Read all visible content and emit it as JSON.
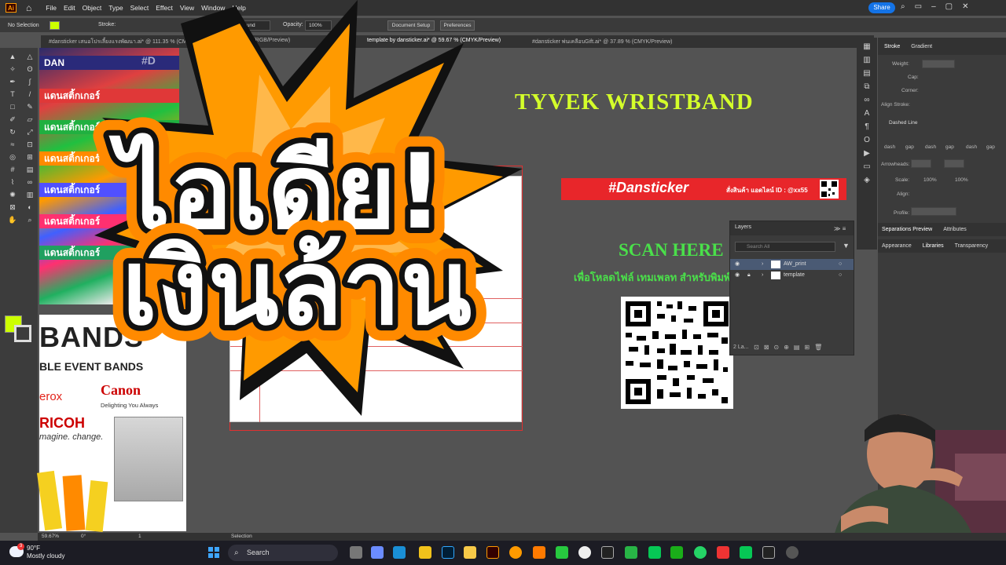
{
  "menubar": {
    "items": [
      "File",
      "Edit",
      "Object",
      "Type",
      "Select",
      "Effect",
      "View",
      "Window",
      "Help"
    ],
    "share_label": "Share"
  },
  "control_bar": {
    "selection_label": "No Selection",
    "stroke_label": "Stroke:",
    "brush_value": "5 pt. Round",
    "opacity_label": "Opacity:",
    "opacity_value": "100%",
    "document_setup_label": "Document Setup",
    "preferences_label": "Preferences"
  },
  "doc_tabs": [
    "#dansticker เสนอโปรเลี้ยงแรงพัฒนา.ai* @ 111.35 % (CMYK/Preview)",
    "Untitled-1* @ 20.8% (RGB/Preview)",
    "template by dansticker.ai* @ 59.67 % (CMYK/Preview)",
    "#dansticker พ่นเคลือบGift.ai* @ 37.89 % (CMYK/Preview)"
  ],
  "artwork": {
    "title": "TYVEK WRISTBAND",
    "banner_brand": "#Dansticker",
    "banner_contact": "สั่งสินค้า แอดไลน์ ID : @xx55",
    "scan_here": "SCAN HERE",
    "download_text": "เพื่อโหลดไฟล์ เทมเพลท สำหรับพิมพ์",
    "photo_bands": [
      "DAN",
      "แดนสติ้กเกอร์",
      "แดนสติ้กเกอร์",
      "แดนสติ้กเกอร์",
      "แดนสติ้กเกอร์",
      "แดนสติ้กเกอร์",
      "แดนสติ้กเกอร์"
    ],
    "photo_tag": "#D",
    "bands_title": "BANDS",
    "bands_subtitle": "BLE EVENT BANDS",
    "xerox": "erox",
    "canon": "Canon",
    "canon_tagline": "Delighting You Always",
    "ricoh": "RICOH",
    "ricoh_tagline": "magine. change."
  },
  "thumbnail_overlay": {
    "line1": "ไอเดีย!",
    "line2": "เงินล้าน"
  },
  "layers_panel": {
    "title": "Layers",
    "search_placeholder": "Search All",
    "layers": [
      "AW_print",
      "template"
    ],
    "footer": "2 La..."
  },
  "right_panel": {
    "tabs": [
      "Stroke",
      "Gradient"
    ],
    "weight_label": "Weight:",
    "cap_label": "Cap:",
    "corner_label": "Corner:",
    "align_stroke_label": "Align Stroke:",
    "dashed_line_label": "Dashed Line",
    "dash_labels": [
      "dash",
      "gap",
      "dash",
      "gap",
      "dash",
      "gap"
    ],
    "arrowheads_label": "Arrowheads:",
    "scale_label": "Scale:",
    "scale_values": [
      "100%",
      "100%"
    ],
    "align_label": "Align:",
    "profile_label": "Profile:",
    "sep_tabs": [
      "Separations Preview",
      "Attributes"
    ],
    "lib_tabs": [
      "Appearance",
      "Libraries",
      "Transparency"
    ]
  },
  "status_bar": {
    "zoom": "59.67%",
    "rotation": "0°",
    "artboard": "1",
    "tool": "Selection"
  },
  "taskbar": {
    "temp": "90°F",
    "weather": "Mostly cloudy",
    "search_label": "Search",
    "weather_badge": "3"
  },
  "colors": {
    "accent_green": "#ccff00",
    "share_blue": "#1473e6",
    "burst_orange": "#ff9a00",
    "banner_red": "#e8262a",
    "scan_green": "#4ae04a"
  }
}
